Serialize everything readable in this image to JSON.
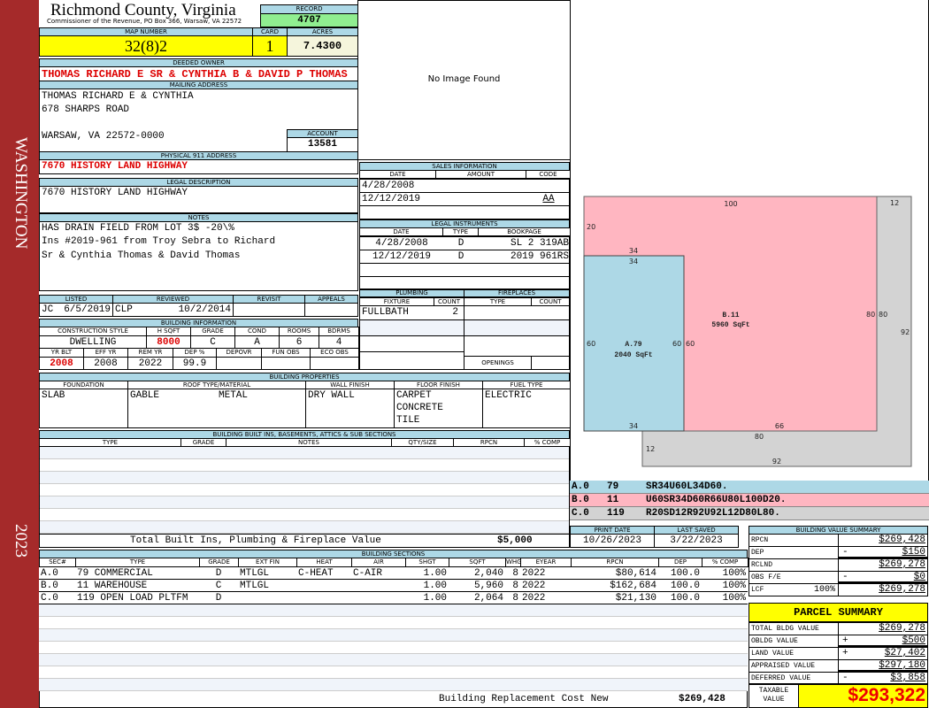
{
  "sidebar": {
    "district": "WASHINGTON",
    "year": "2023"
  },
  "header": {
    "title": "Richmond County, Virginia",
    "subtitle": "Commissioner of the Revenue, PO Box 366, Warsaw, VA 22572",
    "record_label": "RECORD",
    "record": "4707"
  },
  "parcel": {
    "map_label": "MAP NUMBER",
    "map": "32(8)2",
    "card_label": "CARD",
    "card": "1",
    "acres_label": "ACRES",
    "acres": "7.4300"
  },
  "owner": {
    "label": "DEEDED OWNER",
    "value": "THOMAS RICHARD E SR & CYNTHIA B & DAVID P THOMAS"
  },
  "mailing": {
    "label": "MAILING ADDRESS",
    "line1": "THOMAS RICHARD E & CYNTHIA",
    "line2": "678 SHARPS ROAD",
    "line3": "WARSAW, VA 22572-0000",
    "account_label": "ACCOUNT",
    "account": "13581"
  },
  "physical": {
    "label": "PHYSICAL 911 ADDRESS",
    "value": "7670 HISTORY LAND HIGHWAY"
  },
  "legal": {
    "label": "LEGAL DESCRIPTION",
    "value": "7670 HISTORY LAND HIGHWAY"
  },
  "notes": {
    "label": "NOTES",
    "line1": "HAS DRAIN FIELD FROM LOT 3$ -20\\%",
    "line2": "Ins #2019-961 from Troy Sebra to Richard",
    "line3": "Sr & Cynthia Thomas & David Thomas"
  },
  "review": {
    "listed_label": "LISTED",
    "listed_by": "JC",
    "listed_date": "6/5/2019",
    "reviewed_label": "REVIEWED",
    "reviewed_by": "CLP",
    "reviewed_date": "10/2/2014",
    "revisit_label": "REVISIT",
    "appeals_label": "APPEALS"
  },
  "building_info": {
    "label": "BUILDING INFORMATION",
    "h1": [
      "CONSTRUCTION STYLE",
      "H SQFT",
      "GRADE",
      "COND",
      "ROOMS",
      "BDRMS"
    ],
    "v1": [
      "DWELLING",
      "8000",
      "C",
      "A",
      "6",
      "4"
    ],
    "h2": [
      "YR BLT",
      "EFF YR",
      "REM YR",
      "DEP %",
      "DEPOVR",
      "FUN OBS",
      "ECO OBS"
    ],
    "v2": [
      "2008",
      "2008",
      "2022",
      "99.9",
      "",
      "",
      ""
    ]
  },
  "image": {
    "text": "No Image Found"
  },
  "sales": {
    "label": "SALES INFORMATION",
    "cols": [
      "DATE",
      "AMOUNT",
      "CODE"
    ],
    "rows": [
      [
        "4/28/2008",
        "",
        ""
      ],
      [
        "12/12/2019",
        "",
        "AA"
      ]
    ]
  },
  "instruments": {
    "label": "LEGAL INSTRUMENTS",
    "cols": [
      "DATE",
      "TYPE",
      "BOOKPAGE"
    ],
    "rows": [
      [
        "4/28/2008",
        "D",
        "SL 2 319AB"
      ],
      [
        "12/12/2019",
        "D",
        "2019 961RS"
      ]
    ]
  },
  "plumbing": {
    "label": "PLUMBING",
    "cols": [
      "FIXTURE",
      "COUNT"
    ],
    "fixture": "FULLBATH",
    "count": "2"
  },
  "fireplaces": {
    "label": "FIREPLACES",
    "cols": [
      "TYPE",
      "COUNT"
    ],
    "openings": "OPENINGS"
  },
  "properties": {
    "label": "BUILDING PROPERTIES",
    "cols": [
      "FOUNDATION",
      "ROOF TYPE/MATERIAL",
      "WALL FINISH",
      "FLOOR FINISH",
      "FUEL TYPE"
    ],
    "foundation": "SLAB",
    "roof_type": "GABLE",
    "roof_material": "METAL",
    "wall": "DRY WALL",
    "floor1": "CARPET",
    "floor2": "CONCRETE",
    "floor3": "TILE",
    "fuel": "ELECTRIC"
  },
  "builtins": {
    "label": "BUILDING BUILT INS, BASEMENTS, ATTICS & SUB SECTIONS",
    "cols": [
      "TYPE",
      "GRADE",
      "NOTES",
      "QTY/SIZE",
      "RPCN",
      "% COMP"
    ],
    "total_label": "Total Built Ins, Plumbing & Fireplace Value",
    "total": "$5,000"
  },
  "dates": {
    "print_label": "PRINT DATE",
    "print": "10/26/2023",
    "saved_label": "LAST SAVED",
    "saved": "3/22/2023"
  },
  "sections": {
    "label": "BUILDING SECTIONS",
    "cols": [
      "SEC#",
      "TYPE",
      "GRADE",
      "EXT FIN",
      "HEAT",
      "AIR",
      "SHGT",
      "SQFT",
      "WHGT",
      "EYEAR",
      "RPCN",
      "DEP",
      "% COMP"
    ],
    "rows": [
      [
        "A.0",
        "79 COMMERCIAL",
        "D",
        "MTLGL",
        "C-HEAT",
        "C-AIR",
        "1.00",
        "2,040",
        "8",
        "2022",
        "$80,614",
        "100.0",
        "100%"
      ],
      [
        "B.0",
        "11 WAREHOUSE",
        "C",
        "MTLGL",
        "",
        "",
        "1.00",
        "5,960",
        "8",
        "2022",
        "$162,684",
        "100.0",
        "100%"
      ],
      [
        "C.0",
        "119 OPEN LOAD PLTFM",
        "D",
        "",
        "",
        "",
        "1.00",
        "2,064",
        "8",
        "2022",
        "$21,130",
        "100.0",
        "100%"
      ]
    ],
    "total_label": "Building Replacement Cost New",
    "total": "$269,428"
  },
  "sketch": {
    "a_label": "A.79",
    "a_area": "2040 SqFt",
    "b_label": "B.11",
    "b_area": "5960 SqFt",
    "dims": {
      "b_top": "100",
      "b_left": "20",
      "a_top_out": "34",
      "a_top_in": "34",
      "a_left": "60",
      "a_right": "60",
      "b_inner": "60",
      "b_right": "80",
      "c_right_in": "80",
      "c_right": "92",
      "c_top": "12",
      "a_bottom": "34",
      "b_bottom": "66",
      "c_inner_bottom": "80",
      "c_left": "12",
      "c_bottom": "92"
    },
    "codes": [
      [
        "A.0",
        "79",
        "SR34U60L34D60."
      ],
      [
        "B.0",
        "11",
        "U60SR34D60R66U80L100D20."
      ],
      [
        "C.0",
        "119",
        "R20SD12R92U92L12D80L80."
      ]
    ],
    "colors": {
      "a": "#add8e6",
      "b": "#ffb6c1",
      "c": "#d3d3d3"
    }
  },
  "value_summary": {
    "label": "BUILDING VALUE SUMMARY",
    "rows": [
      [
        "RPCN",
        "",
        "$269,428"
      ],
      [
        "DEP",
        "-",
        "$150"
      ],
      [
        "RCLND",
        "",
        "$269,278"
      ],
      [
        "OBS F/E",
        "-",
        "$0"
      ],
      [
        "LCF 100%",
        "",
        "$269,278"
      ]
    ]
  },
  "parcel_summary": {
    "label": "PARCEL SUMMARY",
    "rows": [
      [
        "TOTAL BLDG VALUE",
        "",
        "$269,278"
      ],
      [
        "OBLDG VALUE",
        "+",
        "$500"
      ],
      [
        "LAND VALUE",
        "+",
        "$27,402"
      ],
      [
        "APPRAISED VALUE",
        "",
        "$297,180"
      ],
      [
        "DEFERRED VALUE",
        "-",
        "$3,858"
      ]
    ],
    "taxable_label1": "TAXABLE",
    "taxable_label2": "VALUE",
    "taxable": "$293,322"
  }
}
